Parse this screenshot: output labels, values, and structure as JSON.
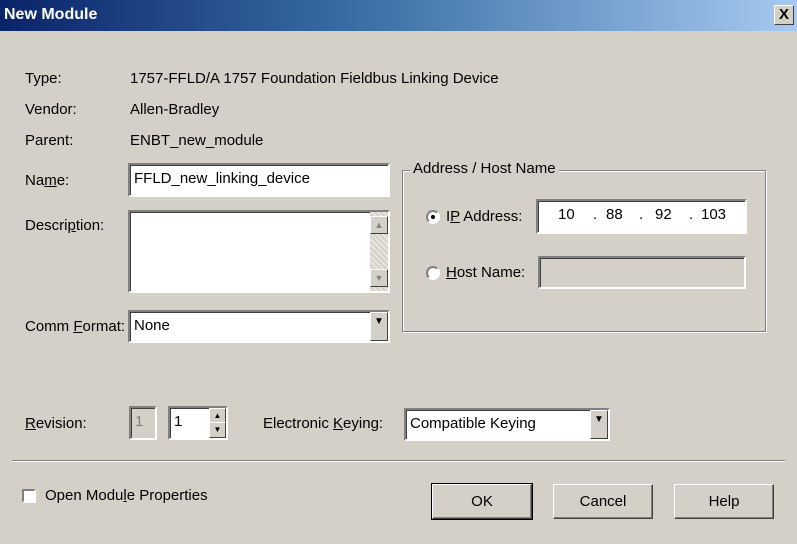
{
  "dialog": {
    "title": "New Module",
    "close_glyph": "X"
  },
  "info": {
    "type_label": "Type:",
    "type_value": "1757-FFLD/A 1757 Foundation Fieldbus Linking Device",
    "vendor_label": "Vendor:",
    "vendor_value": "Allen-Bradley",
    "parent_label": "Parent:",
    "parent_value": "ENBT_new_module"
  },
  "name": {
    "label_pre": "Na",
    "label_key": "m",
    "label_post": "e:",
    "value": "FFLD_new_linking_device"
  },
  "description": {
    "label_pre": "Descri",
    "label_key": "p",
    "label_post": "tion:",
    "value": ""
  },
  "comm_format": {
    "label_pre": "Comm ",
    "label_key": "F",
    "label_post": "ormat:",
    "value": "None"
  },
  "address": {
    "group_label": "Address / Host Name",
    "ip_label_pre": "I",
    "ip_label_key": "P",
    "ip_label_post": " Address:",
    "ip_octets": [
      "10",
      "88",
      "92",
      "103"
    ],
    "ip_selected": true,
    "host_label_key": "H",
    "host_label_post": "ost Name:",
    "host_value": ""
  },
  "revision": {
    "label_key": "R",
    "label_post": "evision:",
    "major": "1",
    "minor": "1"
  },
  "keying": {
    "label_pre": "Electronic ",
    "label_key": "K",
    "label_post": "eying:",
    "value": "Compatible Keying"
  },
  "open_props": {
    "label_pre": "Open Modu",
    "label_key": "l",
    "label_post": "e Properties",
    "checked": false
  },
  "buttons": {
    "ok": "OK",
    "cancel": "Cancel",
    "help": "Help"
  }
}
